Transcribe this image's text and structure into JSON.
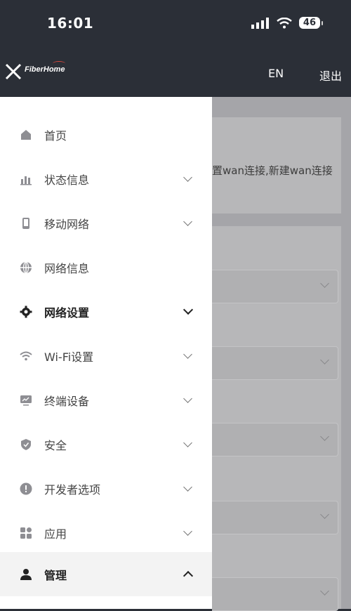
{
  "status_bar": {
    "time": "16:01",
    "battery": "46"
  },
  "header": {
    "lang_label": "EN",
    "logout_label": "退出",
    "logo_text": "FiberHome"
  },
  "background": {
    "card_text": "置wan连接,新建wan连接"
  },
  "menu": {
    "items": [
      {
        "label": "首页",
        "icon": "home-icon",
        "expandable": false
      },
      {
        "label": "状态信息",
        "icon": "bar-chart-icon",
        "expandable": true
      },
      {
        "label": "移动网络",
        "icon": "phone-icon",
        "expandable": true
      },
      {
        "label": "网络信息",
        "icon": "globe-icon",
        "expandable": false
      },
      {
        "label": "网络设置",
        "icon": "gear-icon",
        "expandable": true
      },
      {
        "label": "Wi-Fi设置",
        "icon": "wifi-icon",
        "expandable": true
      },
      {
        "label": "终端设备",
        "icon": "monitor-icon",
        "expandable": true
      },
      {
        "label": "安全",
        "icon": "shield-icon",
        "expandable": true
      },
      {
        "label": "开发者选项",
        "icon": "alert-icon",
        "expandable": true
      },
      {
        "label": "应用",
        "icon": "apps-icon",
        "expandable": true
      },
      {
        "label": "管理",
        "icon": "user-icon",
        "expandable": true,
        "expanded": true
      }
    ]
  },
  "colors": {
    "header_bg": "#2b2f37",
    "drawer_bg": "#ffffff",
    "active_item_bg": "#f3f3f3",
    "overlay": "#a5a5a9"
  }
}
